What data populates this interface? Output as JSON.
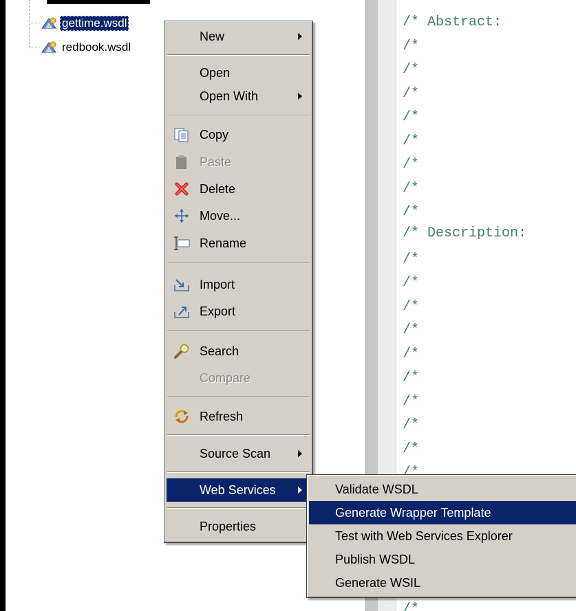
{
  "tree": {
    "items": [
      {
        "label": "gettime.wsdl",
        "selected": true
      },
      {
        "label": "redbook.wsdl",
        "selected": false
      }
    ]
  },
  "editor": {
    "lines": [
      "/* Abstract:",
      "/*",
      "/*",
      "/*",
      "/*",
      "/*",
      "/*",
      "/*",
      "/*",
      "/* Description:",
      "/*",
      "/*",
      "/*",
      "/*",
      "/*",
      "/*",
      "/*",
      "/*",
      "/*",
      "/*",
      "/*",
      "/*",
      "/*",
      "/*",
      "/*",
      "/*"
    ]
  },
  "context_menu": {
    "new": "New",
    "open": "Open",
    "open_with": "Open With",
    "copy": "Copy",
    "paste": "Paste",
    "delete": "Delete",
    "move": "Move...",
    "rename": "Rename",
    "import": "Import",
    "export": "Export",
    "search": "Search",
    "compare": "Compare",
    "refresh": "Refresh",
    "source_scan": "Source Scan",
    "web_services": "Web Services",
    "properties": "Properties"
  },
  "submenu": {
    "validate_wsdl": "Validate WSDL",
    "generate_wrapper_template": "Generate Wrapper Template",
    "test_with_explorer": "Test with Web Services Explorer",
    "publish_wsdl": "Publish WSDL",
    "generate_wsil": "Generate WSIL"
  },
  "colors": {
    "selection": "#0a246a",
    "menu_bg": "#d4d0c8",
    "comment": "#3f7f5f",
    "delete_icon": "#d7261d"
  },
  "icons": [
    "wsdl-file-icon",
    "copy-icon",
    "paste-icon",
    "delete-icon",
    "move-icon",
    "rename-icon",
    "import-icon",
    "export-icon",
    "search-icon",
    "refresh-icon",
    "submenu-arrow-icon"
  ]
}
